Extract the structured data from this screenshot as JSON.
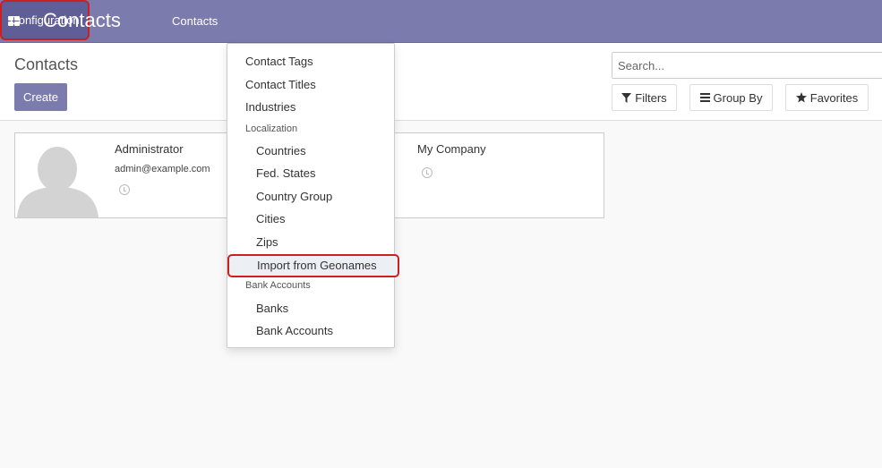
{
  "navbar": {
    "app_title": "Contacts",
    "menu": {
      "contacts": "Contacts",
      "configuration": "Configuration"
    }
  },
  "control_panel": {
    "breadcrumb": "Contacts",
    "create_label": "Create",
    "search_placeholder": "Search...",
    "filters_label": "Filters",
    "groupby_label": "Group By",
    "favorites_label": "Favorites"
  },
  "kanban": {
    "cards": [
      {
        "name": "Administrator",
        "email": "admin@example.com"
      },
      {
        "name": "My Company"
      }
    ]
  },
  "dropdown": {
    "items": [
      "Contact Tags",
      "Contact Titles",
      "Industries"
    ],
    "localization_header": "Localization",
    "localization_items": [
      "Countries",
      "Fed. States",
      "Country Group",
      "Cities",
      "Zips",
      "Import from Geonames"
    ],
    "bank_header": "Bank Accounts",
    "bank_items": [
      "Banks",
      "Bank Accounts"
    ]
  },
  "colors": {
    "brand": "#7c7bad",
    "highlight_border": "#cc1f1f"
  },
  "icons": [
    "apps-grid-icon",
    "filter-icon",
    "list-icon",
    "star-icon",
    "clock-icon",
    "avatar-placeholder-icon"
  ]
}
